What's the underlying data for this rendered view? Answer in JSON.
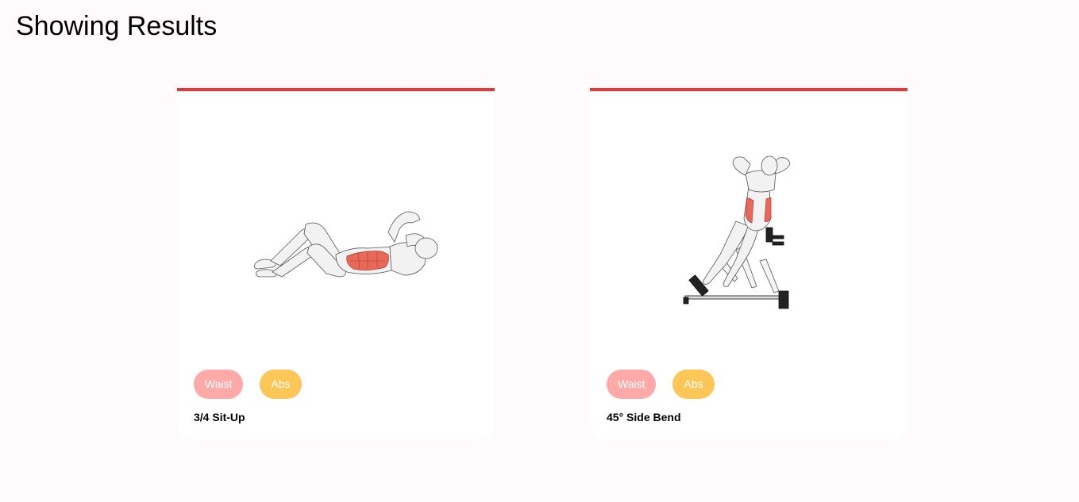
{
  "header": {
    "title": "Showing Results"
  },
  "colors": {
    "accent": "#e83535",
    "waist_tag": "#ffa9a9",
    "abs_tag": "#fcc757",
    "background": "#fffafb"
  },
  "results": [
    {
      "name": "3/4 Sit-Up",
      "tags": [
        "Waist",
        "Abs"
      ],
      "image": "crunch-exercise-illustration"
    },
    {
      "name": "45° Side Bend",
      "tags": [
        "Waist",
        "Abs"
      ],
      "image": "roman-chair-side-bend-illustration"
    }
  ]
}
